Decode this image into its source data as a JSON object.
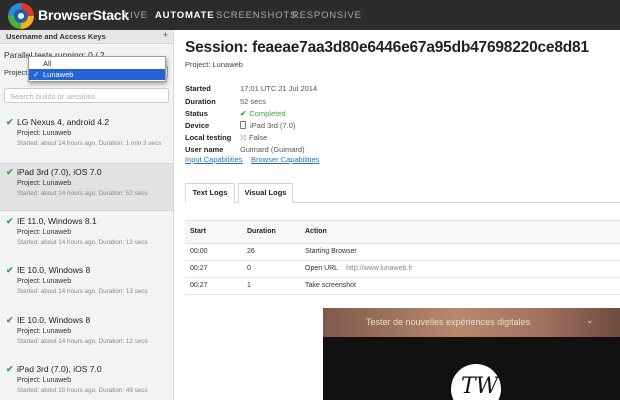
{
  "header": {
    "brand": "BrowserStack",
    "nav": [
      "LIVE",
      "AUTOMATE",
      "SCREENSHOTS",
      "RESPONSIVE"
    ],
    "active_nav": "AUTOMATE"
  },
  "sidebar": {
    "section_title": "Username and Access Keys",
    "plus": "+",
    "parallel": "Parallel tests running: 0 / 2",
    "project_label": "Project:",
    "dropdown_options": [
      {
        "label": "All",
        "selected": false
      },
      {
        "label": "Lunaweb",
        "selected": true
      }
    ],
    "check_mark": "✓",
    "search_placeholder": "Search builds or sessions",
    "builds": [
      {
        "title": "LG Nexus 4, android 4.2",
        "project": "Project: Lunaweb",
        "meta": "Started: about 14 hours ago,  Duration: 1 min 3 secs",
        "selected": false
      },
      {
        "title": "iPad 3rd (7.0), iOS 7.0",
        "project": "Project: Lunaweb",
        "meta": "Started: about 14 hours ago,  Duration: 52 secs",
        "selected": true
      },
      {
        "title": "IE 11.0, Windows 8.1",
        "project": "Project: Lunaweb",
        "meta": "Started: about 14 hours ago,  Duration: 12 secs",
        "selected": false
      },
      {
        "title": "IE 10.0, Windows 8",
        "project": "Project: Lunaweb",
        "meta": "Started: about 14 hours ago,  Duration: 13 secs",
        "selected": false
      },
      {
        "title": "IE 10.0, Windows 8",
        "project": "Project: Lunaweb",
        "meta": "Started: about 14 hours ago,  Duration: 12 secs",
        "selected": false
      },
      {
        "title": "iPad 3rd (7.0), iOS 7.0",
        "project": "Project: Lunaweb",
        "meta": "Started: about 15 hours ago,  Duration: 49 secs",
        "selected": false
      }
    ]
  },
  "session": {
    "title": "Session: feaeae7aa3d80e6446e67a95db47698220ce8d81",
    "project": "Project: Lunaweb",
    "details": [
      {
        "label": "Started",
        "value": "17:01 UTC 21 Jul 2014"
      },
      {
        "label": "Duration",
        "value": "52 secs"
      },
      {
        "label": "Status",
        "value": "Completed"
      },
      {
        "label": "Device",
        "value": "iPad 3rd (7.0)"
      },
      {
        "label": "Local testing",
        "value": "False"
      },
      {
        "label": "User name",
        "value": "Guimard (Guimard)"
      }
    ],
    "links": [
      "Input Capabilities",
      "Browser Capabilities"
    ],
    "tabs": [
      "Text Logs",
      "Visual Logs"
    ],
    "active_tab": "Text Logs"
  },
  "logs": {
    "columns": [
      "Start",
      "Duration",
      "Action"
    ],
    "rows": [
      {
        "start": "00:00",
        "duration": "26",
        "action": "Starting Browser",
        "url": ""
      },
      {
        "start": "00:27",
        "duration": "0",
        "action": "Open URL",
        "url": "http://www.lunaweb.fr"
      },
      {
        "start": "00:27",
        "duration": "1",
        "action": "Take screenshot",
        "url": ""
      }
    ]
  },
  "screenshot": {
    "banner_text": "Tester de nouvelles expériences digitales",
    "chevron": "⌄",
    "logo_text": "TW"
  },
  "colors": {
    "topbar": "#2c2c2c",
    "link": "#2b73b6",
    "success": "#3aa646",
    "selection": "#2563d8"
  }
}
